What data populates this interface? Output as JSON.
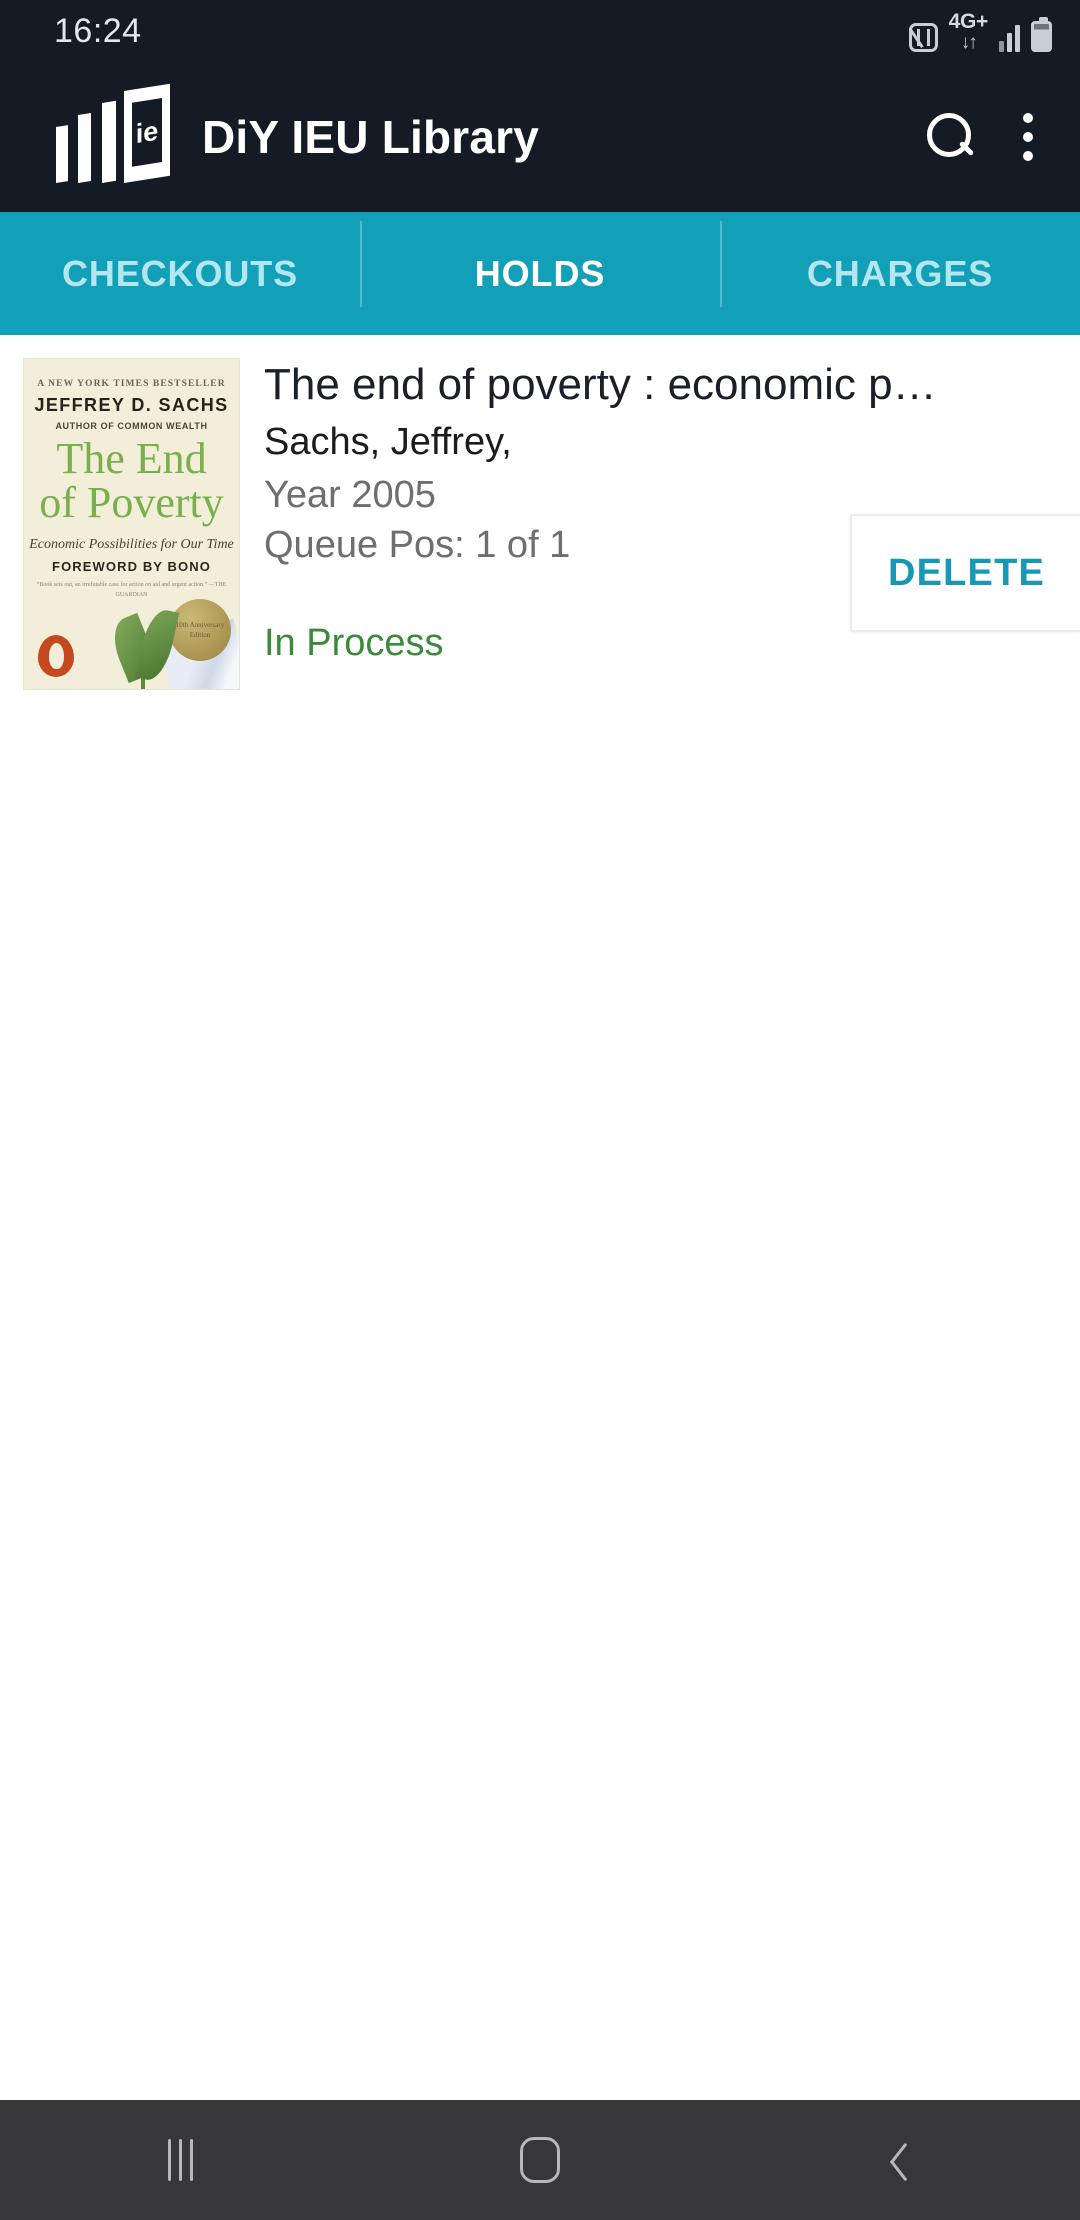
{
  "status_bar": {
    "time": "16:24",
    "nfc_icon": "nfc-icon",
    "network_label": "4G+",
    "network_arrows": "↓↑",
    "signal_icon": "signal-bars-icon",
    "battery_icon": "battery-icon"
  },
  "app_bar": {
    "logo_text": "ie",
    "logo_icon": "library-books-logo-icon",
    "title": "DiY IEU Library",
    "search_icon": "search-icon",
    "overflow_icon": "overflow-menu-icon"
  },
  "tabs": [
    {
      "label": "CHECKOUTS",
      "active": false
    },
    {
      "label": "HOLDS",
      "active": true
    },
    {
      "label": "CHARGES",
      "active": false
    }
  ],
  "holds": [
    {
      "title": "The end of poverty : economic p…",
      "author": "Sachs, Jeffrey,",
      "year": "Year 2005",
      "queue": "Queue Pos: 1 of 1",
      "status": "In Process",
      "delete_label": "DELETE",
      "cover": {
        "bestseller": "A NEW YORK TIMES BESTSELLER",
        "author_line": "JEFFREY D. SACHS",
        "author_sub": "AUTHOR OF COMMON WEALTH",
        "title_line1": "The End",
        "title_line2": "of Poverty",
        "subtitle": "Economic Possibilities for Our Time",
        "foreword": "FOREWORD BY BONO",
        "quote": "“Book sets out, an irrefutable case for action on aid and urgent action.” —THE GUARDIAN",
        "badge": "10th Anniversary Edition",
        "publisher_icon": "penguin-logo-icon"
      }
    }
  ],
  "nav_bar": {
    "recents_icon": "recents-icon",
    "home_icon": "home-icon",
    "back_icon": "back-icon"
  },
  "colors": {
    "app_bar": "#151b24",
    "tab_bar": "#11a0b8",
    "accent": "#1799b3",
    "status_green": "#3a8a3a"
  }
}
